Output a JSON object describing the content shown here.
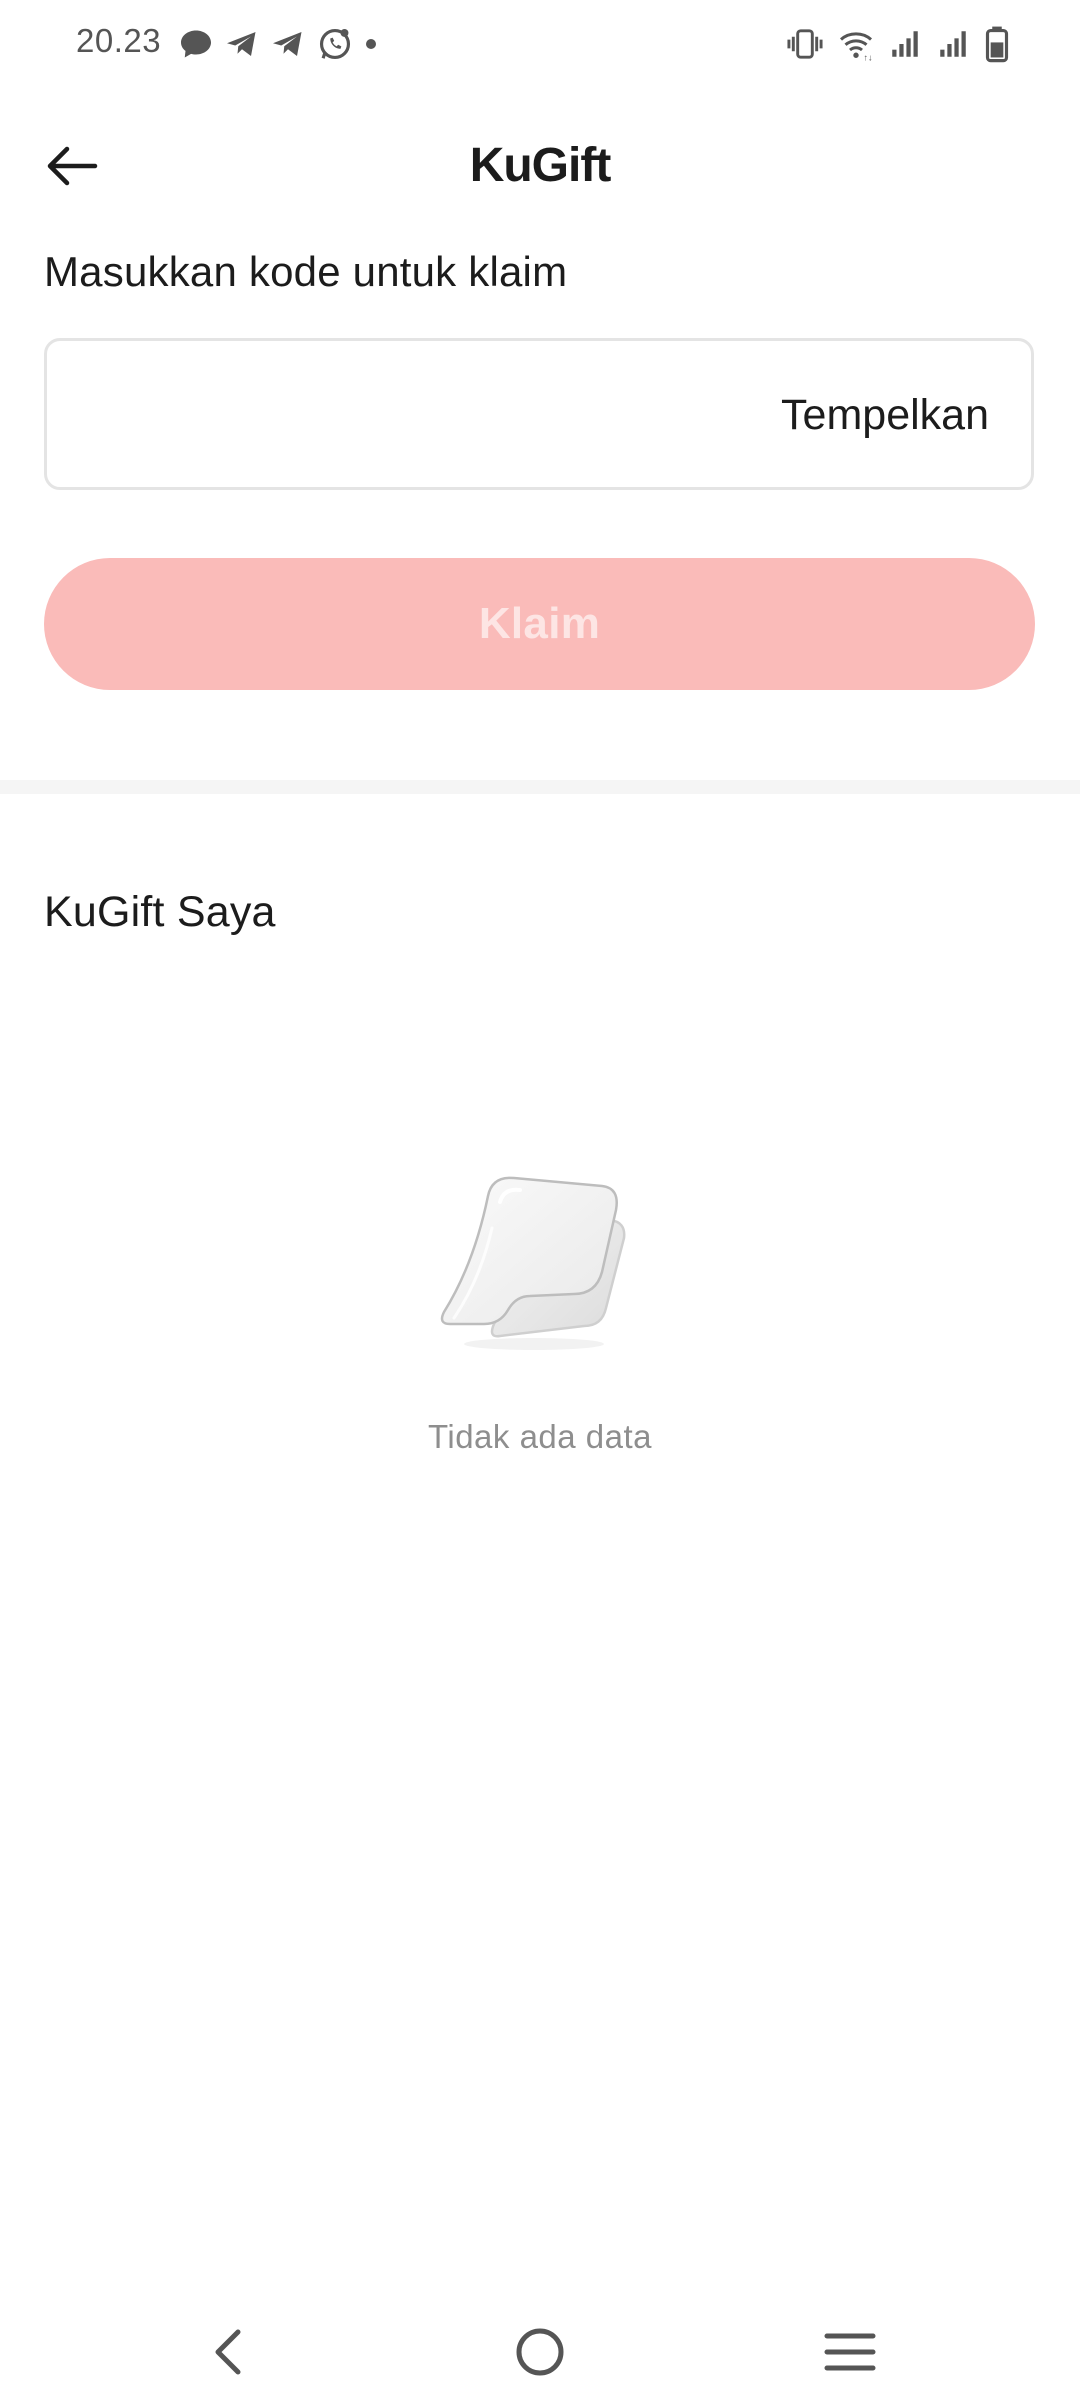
{
  "status_bar": {
    "time": "20.23",
    "left_icons": [
      "chat-bubble-icon",
      "telegram-icon",
      "telegram-icon",
      "whatsapp-business-icon",
      "dot-icon"
    ],
    "right_icons": [
      "vibrate-icon",
      "wifi-icon",
      "signal-icon",
      "signal-icon",
      "battery-icon"
    ]
  },
  "header": {
    "title": "KuGift",
    "back_icon": "arrow-left-icon"
  },
  "claim": {
    "label": "Masukkan kode untuk klaim",
    "input_value": "",
    "input_placeholder": "",
    "paste_label": "Tempelkan",
    "claim_button_label": "Klaim",
    "claim_button_color": "#fabbb9"
  },
  "my_gifts": {
    "title": "KuGift Saya",
    "empty_icon": "empty-box-icon",
    "empty_text": "Tidak ada data"
  },
  "nav_bar": {
    "icons": [
      "nav-back-icon",
      "nav-home-icon",
      "nav-menu-icon"
    ]
  }
}
